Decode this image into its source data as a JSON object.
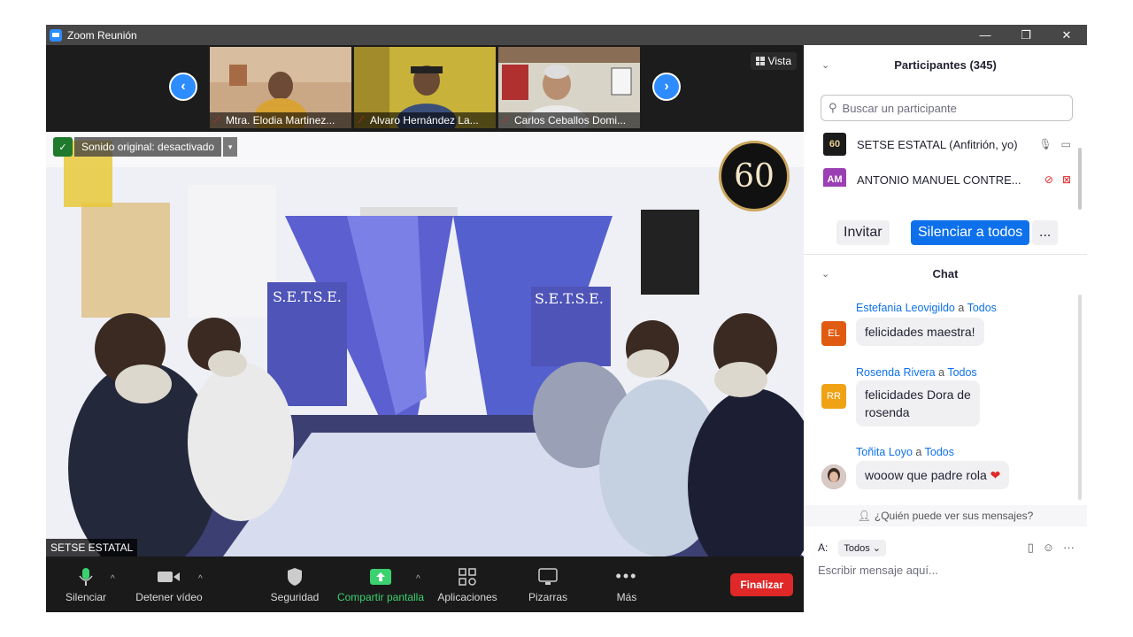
{
  "window": {
    "title": "Zoom Reunión"
  },
  "thumbnails": {
    "view_label": "Vista",
    "items": [
      {
        "name": "Mtra. Elodia Martinez..."
      },
      {
        "name": "Alvaro Hernández La..."
      },
      {
        "name": "Carlos Ceballos Domi..."
      }
    ]
  },
  "main_video": {
    "sound_status": "Sonido original: desactivado",
    "speaker_name": "SETSE ESTATAL",
    "badge_text": "60"
  },
  "toolbar": {
    "mute": "Silenciar",
    "stop_video": "Detener vídeo",
    "security": "Seguridad",
    "share": "Compartir pantalla",
    "apps": "Aplicaciones",
    "whiteboards": "Pizarras",
    "more": "Más",
    "end": "Finalizar"
  },
  "participants": {
    "header": "Participantes (345)",
    "search_placeholder": "Buscar un participante",
    "list": [
      {
        "initials": "60",
        "name": "SETSE ESTATAL (Anfitrión, yo)",
        "color": "#1b1b1b"
      },
      {
        "initials": "AM",
        "name": "ANTONIO MANUEL CONTRE...",
        "color": "#9b3fb5"
      }
    ],
    "invite": "Invitar",
    "mute_all": "Silenciar a todos",
    "more": "..."
  },
  "chat": {
    "header": "Chat",
    "messages": [
      {
        "sender": "Estefania Leovigildo",
        "to_word": "a",
        "to": "Todos",
        "initials": "EL",
        "color": "#e05b12",
        "text": "felicidades maestra!"
      },
      {
        "sender": "Rosenda Rivera",
        "to_word": "a",
        "to": "Todos",
        "initials": "RR",
        "color": "#f0a215",
        "text_line1": "felicidades Dora de",
        "text_line2": "rosenda"
      },
      {
        "sender": "Toñita Loyo",
        "to_word": "a",
        "to": "Todos",
        "initials": "",
        "color": "#6a5a55",
        "text": "wooow que padre rola"
      }
    ],
    "who_can_see": "¿Quién puede ver sus mensajes?",
    "to_label": "A:",
    "to_value": "Todos",
    "compose_placeholder": "Escribir mensaje aquí..."
  }
}
